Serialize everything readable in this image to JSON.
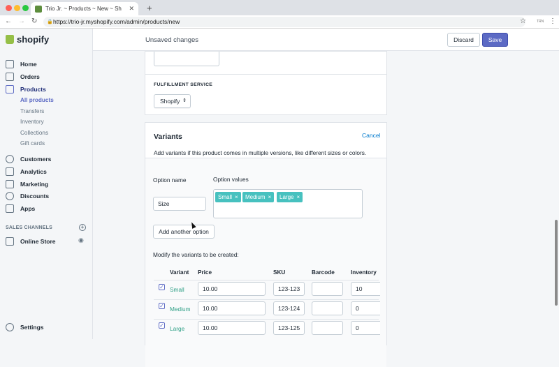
{
  "browser": {
    "tab_title": "Trio Jr. ~ Products ~ New ~ Sh",
    "url": "https://trio-jr.myshopify.com/admin/products/new"
  },
  "sidebar": {
    "brand": "shopify",
    "items": [
      {
        "label": "Home"
      },
      {
        "label": "Orders"
      },
      {
        "label": "Products"
      },
      {
        "label": "Customers"
      },
      {
        "label": "Analytics"
      },
      {
        "label": "Marketing"
      },
      {
        "label": "Discounts"
      },
      {
        "label": "Apps"
      }
    ],
    "product_subitems": [
      {
        "label": "All products"
      },
      {
        "label": "Transfers"
      },
      {
        "label": "Inventory"
      },
      {
        "label": "Collections"
      },
      {
        "label": "Gift cards"
      }
    ],
    "sales_channels_label": "SALES CHANNELS",
    "online_store": "Online Store",
    "settings": "Settings"
  },
  "topbar": {
    "status": "Unsaved changes",
    "discard": "Discard",
    "save": "Save"
  },
  "fulfillment": {
    "label": "FULFILLMENT SERVICE",
    "value": "Shopify"
  },
  "variants": {
    "title": "Variants",
    "cancel": "Cancel",
    "description": "Add variants if this product comes in multiple versions, like different sizes or colors.",
    "option_name_label": "Option name",
    "option_values_label": "Option values",
    "option_name": "Size",
    "option_values": [
      "Small",
      "Medium",
      "Large"
    ],
    "add_option": "Add another option",
    "modify_label": "Modify the variants to be created:",
    "columns": [
      "Variant",
      "Price",
      "SKU",
      "Barcode",
      "Inventory"
    ],
    "rows": [
      {
        "variant": "Small",
        "price": "10.00",
        "sku": "123-123",
        "barcode": "",
        "inventory": "10"
      },
      {
        "variant": "Medium",
        "price": "10.00",
        "sku": "123-124",
        "barcode": "",
        "inventory": "0"
      },
      {
        "variant": "Large",
        "price": "10.00",
        "sku": "123-125",
        "barcode": "",
        "inventory": "0"
      }
    ]
  }
}
